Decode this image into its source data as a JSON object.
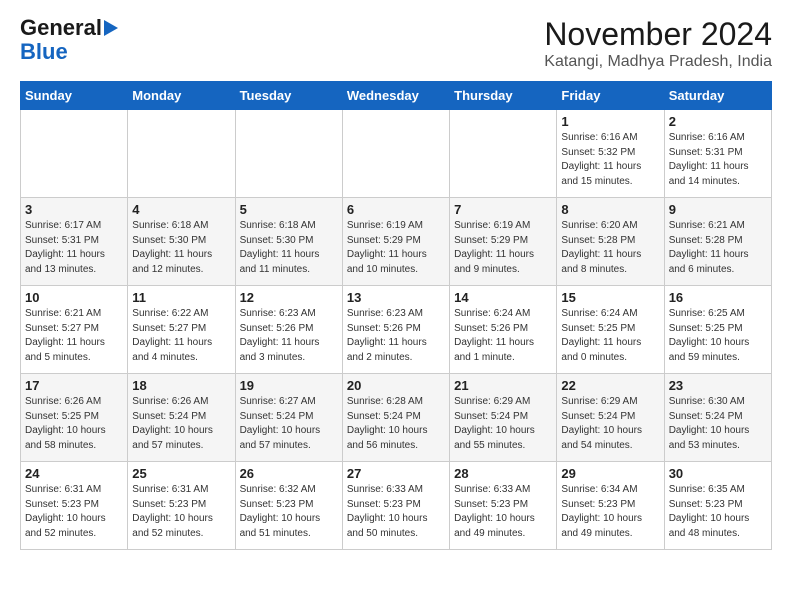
{
  "logo": {
    "line1": "General",
    "line2": "Blue"
  },
  "title": "November 2024",
  "subtitle": "Katangi, Madhya Pradesh, India",
  "days_of_week": [
    "Sunday",
    "Monday",
    "Tuesday",
    "Wednesday",
    "Thursday",
    "Friday",
    "Saturday"
  ],
  "weeks": [
    [
      {
        "day": "",
        "info": ""
      },
      {
        "day": "",
        "info": ""
      },
      {
        "day": "",
        "info": ""
      },
      {
        "day": "",
        "info": ""
      },
      {
        "day": "",
        "info": ""
      },
      {
        "day": "1",
        "info": "Sunrise: 6:16 AM\nSunset: 5:32 PM\nDaylight: 11 hours\nand 15 minutes."
      },
      {
        "day": "2",
        "info": "Sunrise: 6:16 AM\nSunset: 5:31 PM\nDaylight: 11 hours\nand 14 minutes."
      }
    ],
    [
      {
        "day": "3",
        "info": "Sunrise: 6:17 AM\nSunset: 5:31 PM\nDaylight: 11 hours\nand 13 minutes."
      },
      {
        "day": "4",
        "info": "Sunrise: 6:18 AM\nSunset: 5:30 PM\nDaylight: 11 hours\nand 12 minutes."
      },
      {
        "day": "5",
        "info": "Sunrise: 6:18 AM\nSunset: 5:30 PM\nDaylight: 11 hours\nand 11 minutes."
      },
      {
        "day": "6",
        "info": "Sunrise: 6:19 AM\nSunset: 5:29 PM\nDaylight: 11 hours\nand 10 minutes."
      },
      {
        "day": "7",
        "info": "Sunrise: 6:19 AM\nSunset: 5:29 PM\nDaylight: 11 hours\nand 9 minutes."
      },
      {
        "day": "8",
        "info": "Sunrise: 6:20 AM\nSunset: 5:28 PM\nDaylight: 11 hours\nand 8 minutes."
      },
      {
        "day": "9",
        "info": "Sunrise: 6:21 AM\nSunset: 5:28 PM\nDaylight: 11 hours\nand 6 minutes."
      }
    ],
    [
      {
        "day": "10",
        "info": "Sunrise: 6:21 AM\nSunset: 5:27 PM\nDaylight: 11 hours\nand 5 minutes."
      },
      {
        "day": "11",
        "info": "Sunrise: 6:22 AM\nSunset: 5:27 PM\nDaylight: 11 hours\nand 4 minutes."
      },
      {
        "day": "12",
        "info": "Sunrise: 6:23 AM\nSunset: 5:26 PM\nDaylight: 11 hours\nand 3 minutes."
      },
      {
        "day": "13",
        "info": "Sunrise: 6:23 AM\nSunset: 5:26 PM\nDaylight: 11 hours\nand 2 minutes."
      },
      {
        "day": "14",
        "info": "Sunrise: 6:24 AM\nSunset: 5:26 PM\nDaylight: 11 hours\nand 1 minute."
      },
      {
        "day": "15",
        "info": "Sunrise: 6:24 AM\nSunset: 5:25 PM\nDaylight: 11 hours\nand 0 minutes."
      },
      {
        "day": "16",
        "info": "Sunrise: 6:25 AM\nSunset: 5:25 PM\nDaylight: 10 hours\nand 59 minutes."
      }
    ],
    [
      {
        "day": "17",
        "info": "Sunrise: 6:26 AM\nSunset: 5:25 PM\nDaylight: 10 hours\nand 58 minutes."
      },
      {
        "day": "18",
        "info": "Sunrise: 6:26 AM\nSunset: 5:24 PM\nDaylight: 10 hours\nand 57 minutes."
      },
      {
        "day": "19",
        "info": "Sunrise: 6:27 AM\nSunset: 5:24 PM\nDaylight: 10 hours\nand 57 minutes."
      },
      {
        "day": "20",
        "info": "Sunrise: 6:28 AM\nSunset: 5:24 PM\nDaylight: 10 hours\nand 56 minutes."
      },
      {
        "day": "21",
        "info": "Sunrise: 6:29 AM\nSunset: 5:24 PM\nDaylight: 10 hours\nand 55 minutes."
      },
      {
        "day": "22",
        "info": "Sunrise: 6:29 AM\nSunset: 5:24 PM\nDaylight: 10 hours\nand 54 minutes."
      },
      {
        "day": "23",
        "info": "Sunrise: 6:30 AM\nSunset: 5:24 PM\nDaylight: 10 hours\nand 53 minutes."
      }
    ],
    [
      {
        "day": "24",
        "info": "Sunrise: 6:31 AM\nSunset: 5:23 PM\nDaylight: 10 hours\nand 52 minutes."
      },
      {
        "day": "25",
        "info": "Sunrise: 6:31 AM\nSunset: 5:23 PM\nDaylight: 10 hours\nand 52 minutes."
      },
      {
        "day": "26",
        "info": "Sunrise: 6:32 AM\nSunset: 5:23 PM\nDaylight: 10 hours\nand 51 minutes."
      },
      {
        "day": "27",
        "info": "Sunrise: 6:33 AM\nSunset: 5:23 PM\nDaylight: 10 hours\nand 50 minutes."
      },
      {
        "day": "28",
        "info": "Sunrise: 6:33 AM\nSunset: 5:23 PM\nDaylight: 10 hours\nand 49 minutes."
      },
      {
        "day": "29",
        "info": "Sunrise: 6:34 AM\nSunset: 5:23 PM\nDaylight: 10 hours\nand 49 minutes."
      },
      {
        "day": "30",
        "info": "Sunrise: 6:35 AM\nSunset: 5:23 PM\nDaylight: 10 hours\nand 48 minutes."
      }
    ]
  ]
}
